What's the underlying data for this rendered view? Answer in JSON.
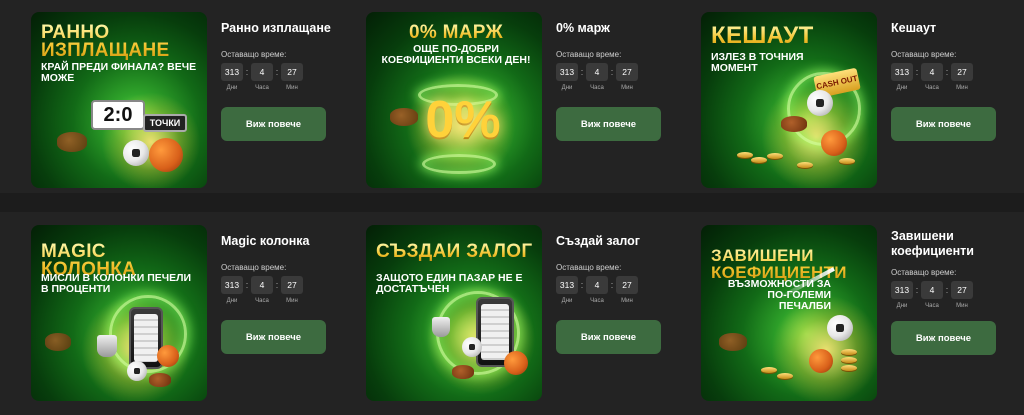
{
  "timer_labels": {
    "remaining": "Оставащо време:",
    "days": "Дни",
    "hours": "Часа",
    "minutes": "Мин"
  },
  "button_label": "Виж повече",
  "cards": [
    {
      "title": "Ранно изплащане",
      "banner_title": "Ранно изплащане",
      "banner_sub": "Край преди финала? Вече може",
      "badge_score": "2:0",
      "badge_points": "точки",
      "days": "313",
      "hours": "4",
      "minutes": "27"
    },
    {
      "title": "0% марж",
      "banner_title": "0% Марж",
      "banner_sub": "Още по-добри коефициенти всеки ден!",
      "big_value": "0%",
      "days": "313",
      "hours": "4",
      "minutes": "27"
    },
    {
      "title": "Кешаут",
      "banner_title": "Кешаут",
      "banner_sub": "Излез в точния момент",
      "badge_cash": "CASH OUT",
      "days": "313",
      "hours": "4",
      "minutes": "27"
    },
    {
      "title": "Magic колонка",
      "banner_title": "Magic колонка",
      "banner_sub": "Мисли в колонки печели в проценти",
      "days": "313",
      "hours": "4",
      "minutes": "27"
    },
    {
      "title": "Създай залог",
      "banner_title": "Създай залог",
      "banner_sub": "Защото един пазар не е достатъчен",
      "days": "313",
      "hours": "4",
      "minutes": "27"
    },
    {
      "title": "Завишени коефициенти",
      "banner_title": "Завишени коефициенти",
      "banner_sub": "Възможности за по-големи печалби",
      "days": "313",
      "hours": "4",
      "minutes": "27"
    }
  ],
  "colors": {
    "page_bg": "#1c1c1c",
    "panel_bg": "#232323",
    "button_bg": "#3d6b40",
    "timer_box": "#3a3a3a",
    "banner_title_gold": "#f4c430"
  }
}
